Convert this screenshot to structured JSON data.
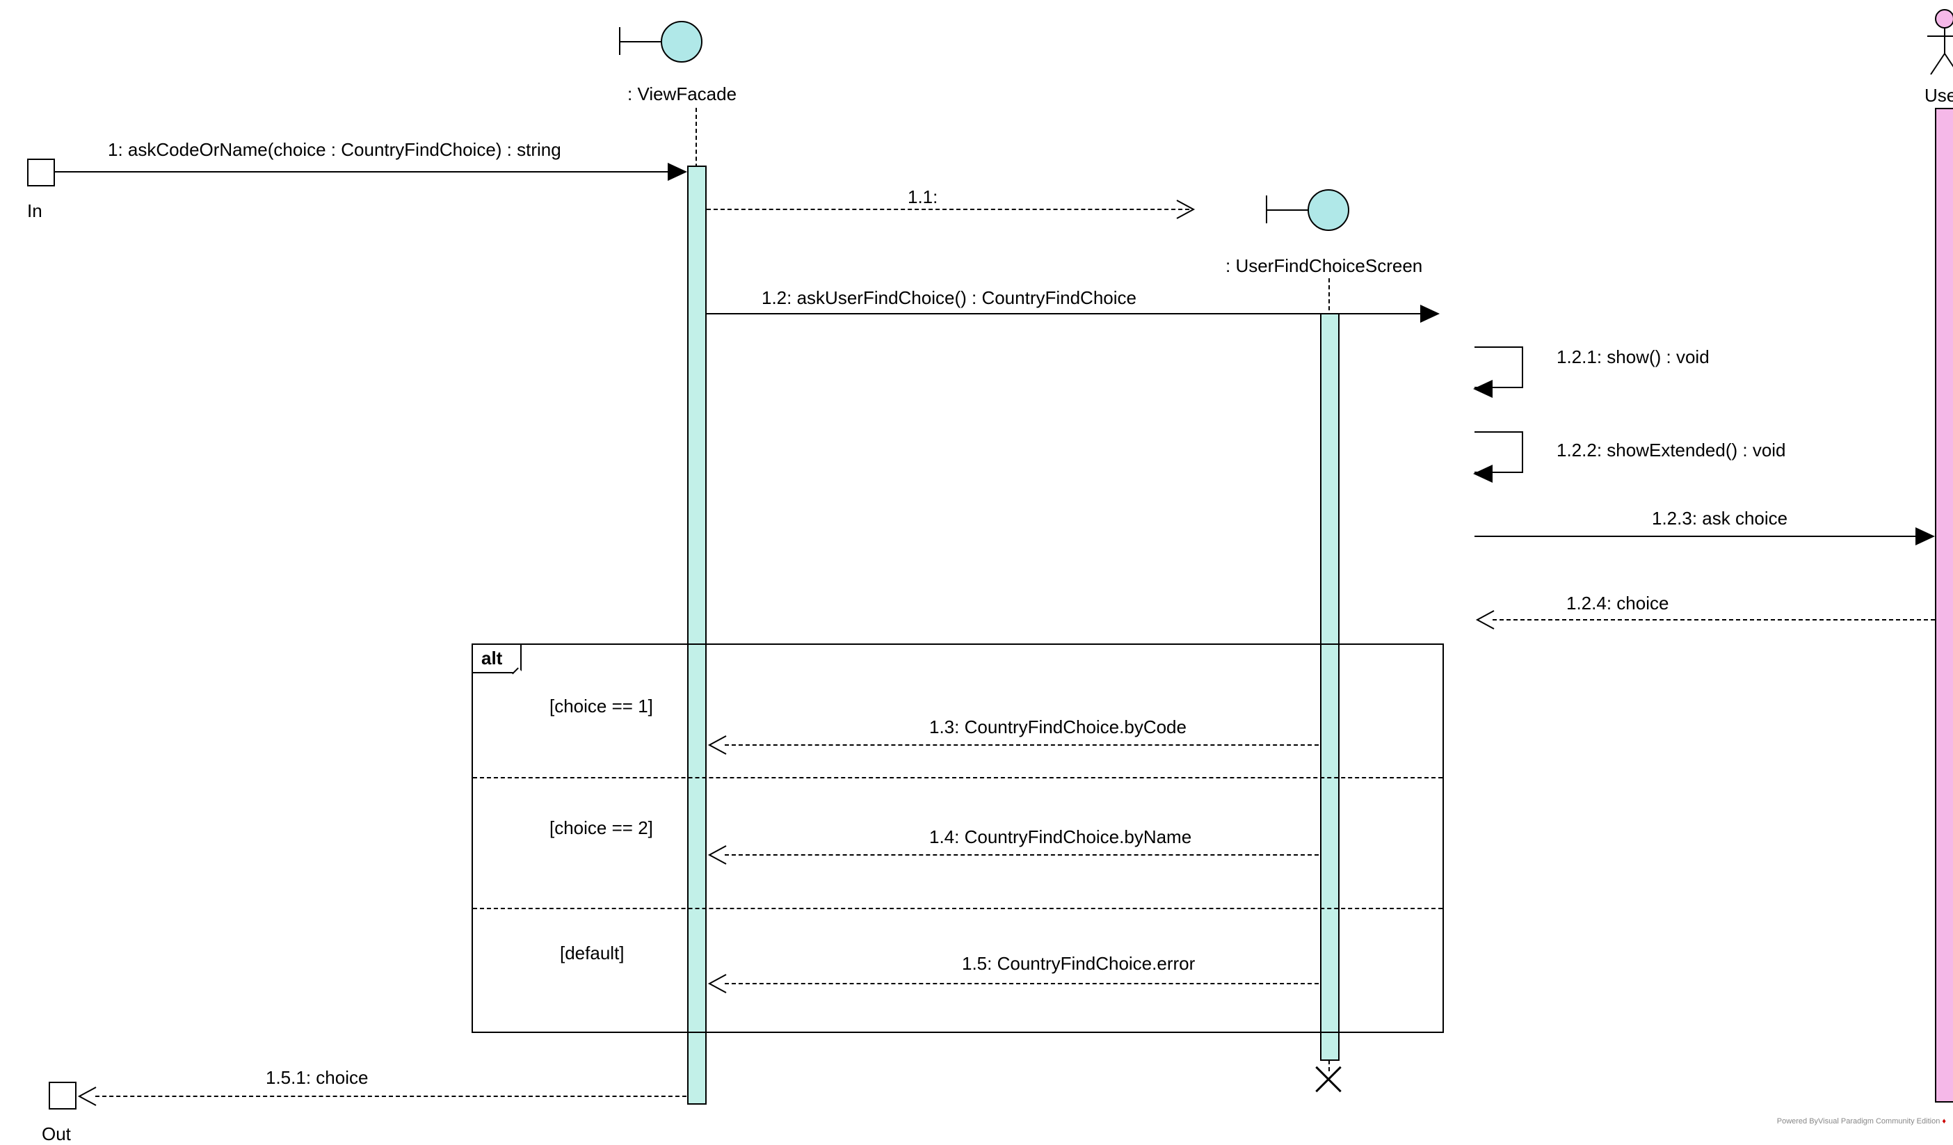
{
  "lifelines": {
    "viewFacade": ": ViewFacade",
    "userFindChoiceScreen": ": UserFindChoiceScreen",
    "user": "User"
  },
  "gates": {
    "in": "In",
    "out": "Out"
  },
  "messages": {
    "m1": "1: askCodeOrName(choice : CountryFindChoice) : string",
    "m1_1": "1.1:",
    "m1_2": "1.2: askUserFindChoice() : CountryFindChoice",
    "m1_2_1": "1.2.1: show() : void",
    "m1_2_2": "1.2.2: showExtended() : void",
    "m1_2_3": "1.2.3: ask choice",
    "m1_2_4": "1.2.4: choice",
    "m1_3": "1.3: CountryFindChoice.byCode",
    "m1_4": "1.4: CountryFindChoice.byName",
    "m1_5": "1.5: CountryFindChoice.error",
    "m1_5_1": "1.5.1: choice"
  },
  "altFrame": {
    "label": "alt",
    "guards": {
      "g1": "[choice == 1]",
      "g2": "[choice == 2]",
      "g3": "[default]"
    }
  },
  "watermark": "Powered ByVisual Paradigm Community Edition"
}
